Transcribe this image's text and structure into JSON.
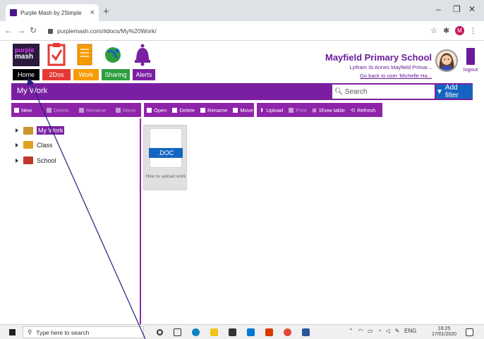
{
  "browser": {
    "tab_title": "Purple Mash by 2Simple",
    "tab_close": "×",
    "new_tab": "+",
    "url": "purplemash.com/#docs/My%20Work/",
    "profile_initial": "M"
  },
  "header": {
    "logo_top": "purple",
    "logo_bottom": "mash",
    "nav": [
      {
        "label": "Home",
        "color": "#000000"
      },
      {
        "label": "2Dos",
        "color": "#e53935"
      },
      {
        "label": "Work",
        "color": "#f59c00"
      },
      {
        "label": "Sharing",
        "color": "#2e9e3e"
      },
      {
        "label": "Alerts",
        "color": "#7b1fa2"
      }
    ],
    "school_name": "Mayfield Primary School",
    "school_sub": "Lytham St Annes Mayfield Primar...",
    "back_link": "Go back to user 'Michelle Ha...",
    "logout": "logout"
  },
  "titlebar": {
    "title": "My Work",
    "search_placeholder": "Search",
    "filter_label": "Add filter"
  },
  "left_toolbar": [
    {
      "label": "New",
      "enabled": true
    },
    {
      "label": "Delete",
      "enabled": false
    },
    {
      "label": "Rename",
      "enabled": false
    },
    {
      "label": "Move",
      "enabled": false
    }
  ],
  "right_toolbar_1": [
    {
      "label": "Open",
      "enabled": true
    },
    {
      "label": "Delete",
      "enabled": true
    },
    {
      "label": "Rename",
      "enabled": true
    },
    {
      "label": "Move",
      "enabled": true
    }
  ],
  "right_toolbar_2": [
    {
      "label": "Upload",
      "enabled": true
    },
    {
      "label": "Print",
      "enabled": false
    },
    {
      "label": "Show table",
      "enabled": true
    },
    {
      "label": "Refresh",
      "enabled": true
    }
  ],
  "tree": [
    {
      "label": "My Work",
      "selected": true,
      "icon_color": "#c8962a"
    },
    {
      "label": "Class",
      "selected": false,
      "icon_color": "#e0a020"
    },
    {
      "label": "School",
      "selected": false,
      "icon_color": "#c0392b"
    }
  ],
  "file": {
    "badge": ".DOC",
    "caption": "How to upload work"
  },
  "taskbar": {
    "search_placeholder": "Type here to search",
    "tray_lang": "ENG",
    "time": "16:25",
    "date": "17/01/2020"
  },
  "colors": {
    "brand_purple": "#7b1fa2",
    "toolbar_purple": "#8e24aa",
    "filter_blue": "#1565c0"
  }
}
